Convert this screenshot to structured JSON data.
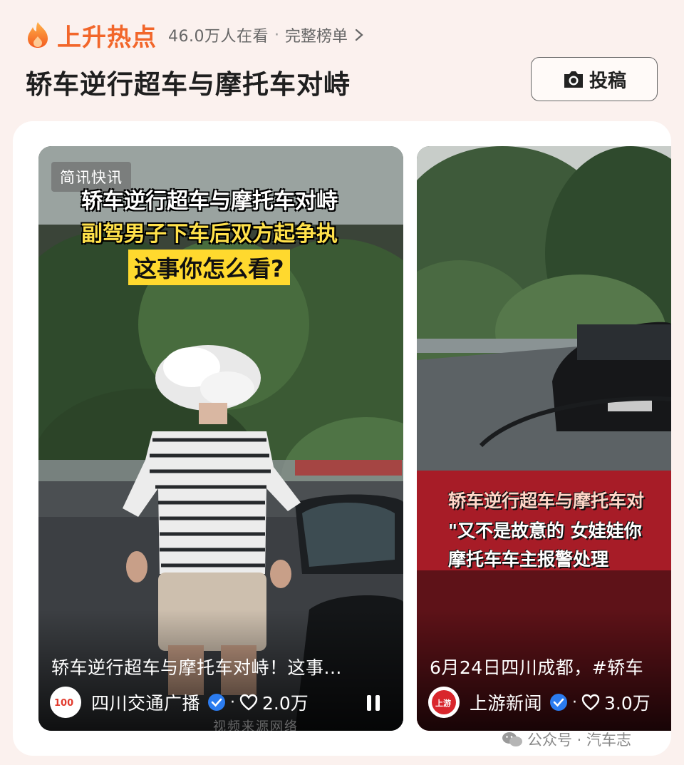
{
  "header": {
    "trend_label": "上升热点",
    "viewers": "46.0万人在看",
    "separator": "·",
    "full_list": "完整榜单"
  },
  "topic": {
    "title": "轿车逆行超车与摩托车对峙"
  },
  "submit_button": {
    "label": "投稿"
  },
  "cards": [
    {
      "tag": "简讯快讯",
      "caption_lines": [
        "轿车逆行超车与摩托车对峙",
        "副驾男子下车后双方起争执",
        "这事你怎么看?"
      ],
      "title": "轿车逆行超车与摩托车对峙！这事...",
      "author": "四川交通广播",
      "avatar_text": "100",
      "likes": "2.0万",
      "source_watermark": "视频来源网络"
    },
    {
      "caption_lines": [
        "轿车逆行超车与摩托车对",
        "\"又不是故意的 女娃娃你",
        "摩托车车主报警处理"
      ],
      "title": "6月24日四川成都，#轿车",
      "author": "上游新闻",
      "avatar_text": "上游",
      "likes": "3.0万"
    }
  ],
  "footer_watermark": "公众号 · 汽车志",
  "colors": {
    "accent": "#f2662a",
    "background": "#fbf1ee",
    "verified": "#2b7cf0",
    "highlight_yellow": "#ffd92e"
  },
  "icons": [
    "flame-icon",
    "chevron-right-icon",
    "camera-icon",
    "verified-icon",
    "heart-icon",
    "pause-icon",
    "wechat-icon"
  ]
}
